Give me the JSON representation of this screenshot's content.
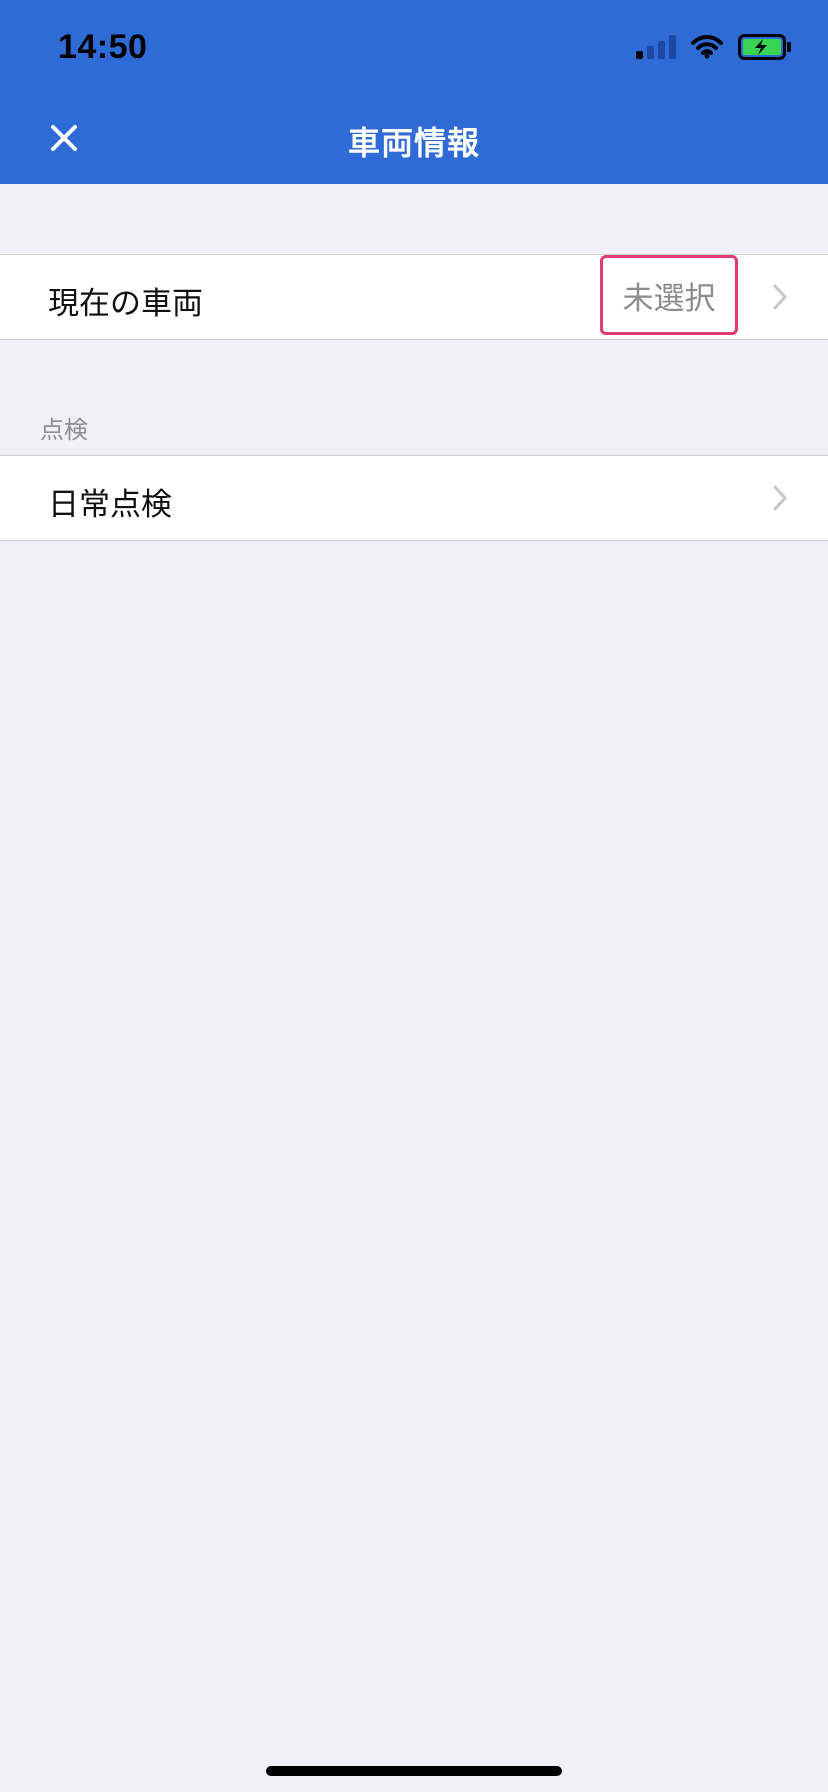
{
  "status_bar": {
    "time": "14:50",
    "icons": [
      "signal-icon",
      "wifi-icon",
      "battery-charging-icon"
    ]
  },
  "header": {
    "title": "車両情報",
    "close_icon": "close-icon"
  },
  "rows": {
    "current_vehicle": {
      "label": "現在の車両",
      "value": "未選択"
    },
    "daily_inspection": {
      "label": "日常点検"
    }
  },
  "section": {
    "inspection_header": "点検"
  },
  "colors": {
    "header_bg": "#2f6bd6",
    "page_bg": "#f1eff7",
    "highlight": "#e23a73",
    "battery_green": "#39d454"
  }
}
